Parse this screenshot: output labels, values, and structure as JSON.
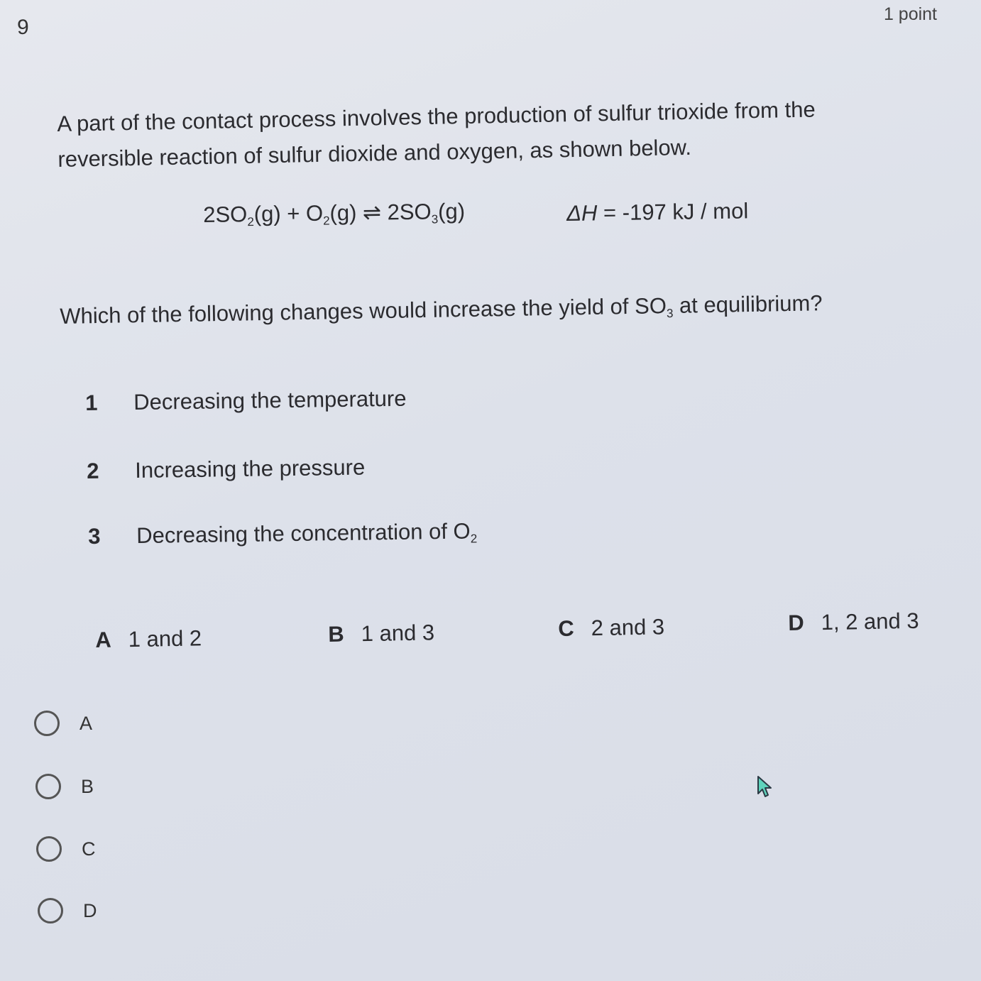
{
  "question": {
    "number": "9",
    "points": "1 point",
    "stem": "A part of the contact process involves the production of sulfur trioxide from the reversible reaction of sulfur dioxide and oxygen, as shown below.",
    "equation": {
      "reactant1_coef": "2SO",
      "reactant1_sub": "2",
      "reactant1_state": "(g) + O",
      "reactant2_sub": "2",
      "reactant2_state": "(g) ⇌ 2SO",
      "product_sub": "3",
      "product_state": "(g)"
    },
    "enthalpy": {
      "symbol": "ΔH",
      "value": " = -197 kJ / mol"
    },
    "prompt": {
      "before": "Which of the following changes would increase the yield of SO",
      "sub": "3",
      "after": " at equilibrium?"
    },
    "statements": [
      {
        "num": "1",
        "text": "Decreasing the temperature",
        "sub": ""
      },
      {
        "num": "2",
        "text": "Increasing the pressure",
        "sub": ""
      },
      {
        "num": "3",
        "text": "Decreasing the concentration of O",
        "sub": "2"
      }
    ],
    "answer_key": [
      {
        "letter": "A",
        "text": "1 and 2"
      },
      {
        "letter": "B",
        "text": "1 and 3"
      },
      {
        "letter": "C",
        "text": "2 and 3"
      },
      {
        "letter": "D",
        "text": "1, 2 and 3"
      }
    ],
    "choices": [
      {
        "label": "A",
        "selected": false
      },
      {
        "label": "B",
        "selected": false
      },
      {
        "label": "C",
        "selected": false
      },
      {
        "label": "D",
        "selected": false
      }
    ]
  },
  "colors": {
    "cursor_fill": "#5fd3bc",
    "cursor_stroke": "#2b3a44"
  }
}
